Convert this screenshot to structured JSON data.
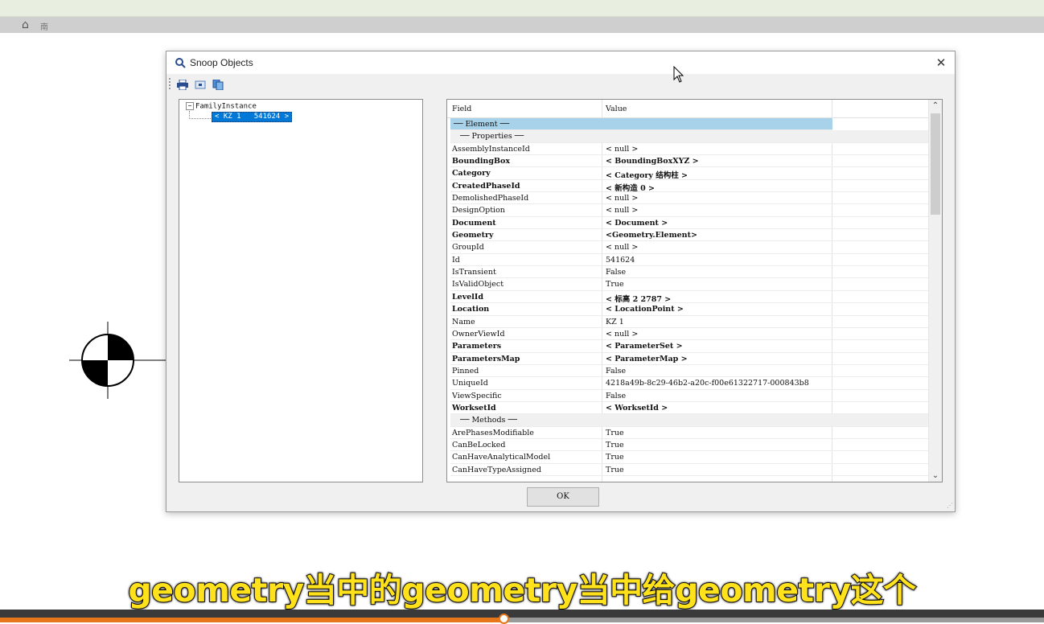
{
  "app": {
    "nav_label": "南"
  },
  "dialog": {
    "title": "Snoop Objects",
    "close_glyph": "✕",
    "ok_label": "OK",
    "tree": {
      "root_label": "FamilyInstance",
      "expander_glyph": "−",
      "child_label": "< KZ 1   541624 >"
    },
    "grid": {
      "header_field": "Field",
      "header_value": "Value",
      "rows": [
        {
          "field": "── Element ──",
          "value": "",
          "kind": "section"
        },
        {
          "field": "── Properties ──",
          "value": "",
          "kind": "sub"
        },
        {
          "field": "AssemblyInstanceId",
          "value": "< null >",
          "kind": "normal"
        },
        {
          "field": "BoundingBox",
          "value": "< BoundingBoxXYZ >",
          "kind": "bold"
        },
        {
          "field": "Category",
          "value": "< Category  结构柱 >",
          "kind": "bold"
        },
        {
          "field": "CreatedPhaseId",
          "value": "< 新构造  0 >",
          "kind": "bold"
        },
        {
          "field": "DemolishedPhaseId",
          "value": "< null >",
          "kind": "normal"
        },
        {
          "field": "DesignOption",
          "value": "< null >",
          "kind": "normal"
        },
        {
          "field": "Document",
          "value": "< Document >",
          "kind": "bold"
        },
        {
          "field": "Geometry",
          "value": "<Geometry.Element>",
          "kind": "bold"
        },
        {
          "field": "GroupId",
          "value": "< null >",
          "kind": "normal"
        },
        {
          "field": "Id",
          "value": "541624",
          "kind": "normal"
        },
        {
          "field": "IsTransient",
          "value": "False",
          "kind": "normal"
        },
        {
          "field": "IsValidObject",
          "value": "True",
          "kind": "normal"
        },
        {
          "field": "LevelId",
          "value": "< 标高 2  2787 >",
          "kind": "bold"
        },
        {
          "field": "Location",
          "value": "< LocationPoint >",
          "kind": "bold"
        },
        {
          "field": "Name",
          "value": "KZ 1",
          "kind": "normal"
        },
        {
          "field": "OwnerViewId",
          "value": "< null >",
          "kind": "normal"
        },
        {
          "field": "Parameters",
          "value": "< ParameterSet >",
          "kind": "bold"
        },
        {
          "field": "ParametersMap",
          "value": "< ParameterMap >",
          "kind": "bold"
        },
        {
          "field": "Pinned",
          "value": "False",
          "kind": "normal"
        },
        {
          "field": "UniqueId",
          "value": "4218a49b-8c29-46b2-a20c-f00e61322717-000843b8",
          "kind": "normal"
        },
        {
          "field": "ViewSpecific",
          "value": "False",
          "kind": "normal"
        },
        {
          "field": "WorksetId",
          "value": "< WorksetId >",
          "kind": "bold"
        },
        {
          "field": "── Methods ──",
          "value": "",
          "kind": "sub"
        },
        {
          "field": "ArePhasesModifiable",
          "value": "True",
          "kind": "normal"
        },
        {
          "field": "CanBeLocked",
          "value": "True",
          "kind": "normal"
        },
        {
          "field": "CanHaveAnalyticalModel",
          "value": "True",
          "kind": "normal"
        },
        {
          "field": "CanHaveTypeAssigned",
          "value": "True",
          "kind": "normal"
        }
      ]
    }
  },
  "subtitle": "geometry当中的geometry当中给geometry这个",
  "video": {
    "progress_fraction": 0.482,
    "accent_color": "#e8761a"
  },
  "colors": {
    "selection": "#0078d7",
    "section_row": "#a8d2ea",
    "subtitle_text": "#ffe21c"
  }
}
